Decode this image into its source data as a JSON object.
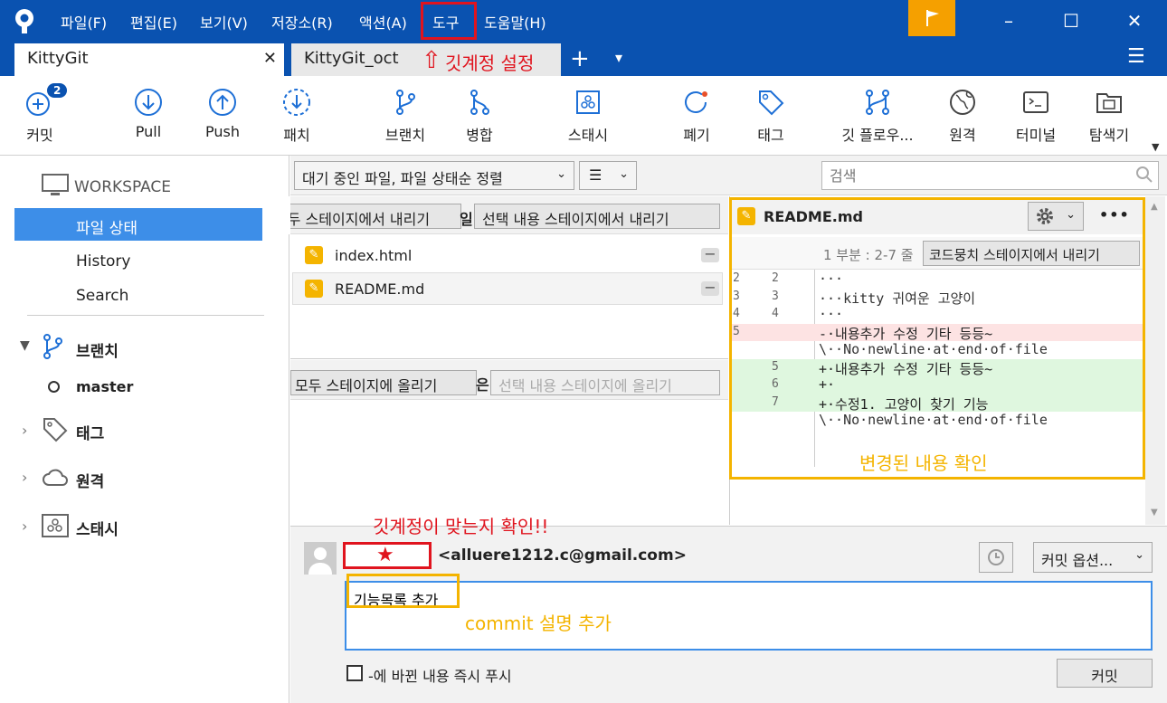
{
  "menu": [
    "파일(F)",
    "편집(E)",
    "보기(V)",
    "저장소(R)",
    "액션(A)",
    "도구",
    "도움말(H)"
  ],
  "window_controls": {
    "minimize": "–",
    "maximize": "☐",
    "close": "✕"
  },
  "tabs": [
    {
      "label": "KittyGit",
      "close": "✕"
    },
    {
      "label": "KittyGit_oct"
    }
  ],
  "tab_add": "+",
  "tab_dropdown": "▾",
  "hamburger": "☰",
  "toolbar": [
    {
      "label": "커밋",
      "icon": "plus-circle-icon",
      "badge": "2"
    },
    {
      "label": "Pull",
      "icon": "arrow-down-circle-icon"
    },
    {
      "label": "Push",
      "icon": "arrow-up-circle-icon"
    },
    {
      "label": "패치",
      "icon": "patch-icon"
    },
    {
      "label": "브랜치",
      "icon": "branch-icon"
    },
    {
      "label": "병합",
      "icon": "merge-icon"
    },
    {
      "label": "스태시",
      "icon": "stash-icon"
    },
    {
      "label": "폐기",
      "icon": "discard-icon"
    },
    {
      "label": "태그",
      "icon": "tag-icon"
    },
    {
      "label": "깃 플로우...",
      "icon": "gitflow-icon"
    },
    {
      "label": "원격",
      "icon": "globe-icon"
    },
    {
      "label": "터미널",
      "icon": "terminal-icon"
    },
    {
      "label": "탐색기",
      "icon": "explorer-icon"
    }
  ],
  "sidebar": {
    "workspace": "WORKSPACE",
    "items": [
      "파일 상태",
      "History",
      "Search"
    ],
    "branches": "브랜치",
    "branch_master": "master",
    "tags": "태그",
    "remotes": "원격",
    "stashes": "스태시"
  },
  "filter": {
    "sort_label": "대기 중인 파일, 파일 상태순 정렬",
    "view_icon": "☰",
    "search_placeholder": "검색"
  },
  "staged": {
    "unstage_all": "모두 스테이지에서 내리기",
    "header_suffix": "일",
    "unstage_selected": "선택 내용 스테이지에서 내리기",
    "files": [
      "index.html",
      "README.md"
    ]
  },
  "unstaged": {
    "stage_all": "모두 스테이지에 올리기",
    "header_text": "은 파일",
    "stage_selected": "선택 내용 스테이지에 올리기"
  },
  "diff": {
    "filename": "README.md",
    "more": "•••",
    "hunk_label": "1 부분 : 2-7 줄",
    "hunk_button": "코드뭉치 스테이지에서 내리기",
    "lines": [
      {
        "old": "2",
        "new": "2",
        "text": "···",
        "type": "ctx"
      },
      {
        "old": "3",
        "new": "3",
        "text": "···kitty 귀여운 고양이",
        "type": "ctx"
      },
      {
        "old": "4",
        "new": "4",
        "text": "···",
        "type": "ctx"
      },
      {
        "old": "5",
        "new": "",
        "text": "-·내용추가 수정 기타 등등~",
        "type": "del"
      },
      {
        "old": "",
        "new": "",
        "text": "\\··No·newline·at·end·of·file",
        "type": "ctx"
      },
      {
        "old": "",
        "new": "5",
        "text": "+·내용추가 수정 기타 등등~",
        "type": "add"
      },
      {
        "old": "",
        "new": "6",
        "text": "+·",
        "type": "add"
      },
      {
        "old": "",
        "new": "7",
        "text": "+·수정1. 고양이 찾기 기능",
        "type": "add"
      },
      {
        "old": "",
        "new": "",
        "text": "\\··No·newline·at·end·of·file",
        "type": "ctx"
      }
    ]
  },
  "commit": {
    "author_name": "★",
    "email": "<alluere1212.c@gmail.com>",
    "options": "커밋 옵션...",
    "message": "기능목록 추가",
    "push_label": "-에 바뀐 내용 즉시 푸시",
    "commit_button": "커밋"
  },
  "annotations": {
    "git_account_setting": "깃계정 설정",
    "arrow": "⇧",
    "check_account": "깃계정이 맞는지 확인!!",
    "check_changes": "변경된 내용 확인",
    "add_commit_desc": "commit 설명 추가"
  },
  "colors": {
    "titlebar": "#0a52b0",
    "accent": "#3d8ee8",
    "annotation_red": "#e0141e",
    "annotation_yellow": "#f4b400",
    "flag": "#f5a000"
  }
}
